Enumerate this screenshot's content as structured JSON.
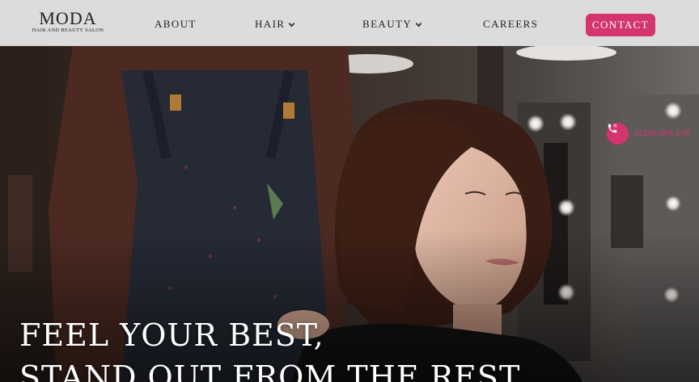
{
  "brand": {
    "name": "MODA",
    "tagline": "HAIR AND BEAUTY SALON"
  },
  "nav": {
    "items": [
      {
        "label": "ABOUT",
        "dropdown": false
      },
      {
        "label": "HAIR",
        "dropdown": true
      },
      {
        "label": "BEAUTY",
        "dropdown": true
      },
      {
        "label": "CAREERS",
        "dropdown": false
      }
    ],
    "contact_label": "CONTACT"
  },
  "hero": {
    "phone": "01245-354-148",
    "headline_line1": "FEEL YOUR BEST,",
    "headline_line2": "STAND OUT FROM THE REST."
  },
  "colors": {
    "accent": "#d4356e",
    "nav_bg": "#dcdcdc",
    "headline": "#ffffff"
  },
  "icons": {
    "phone": "phone-icon",
    "chevron": "chevron-down-icon"
  }
}
